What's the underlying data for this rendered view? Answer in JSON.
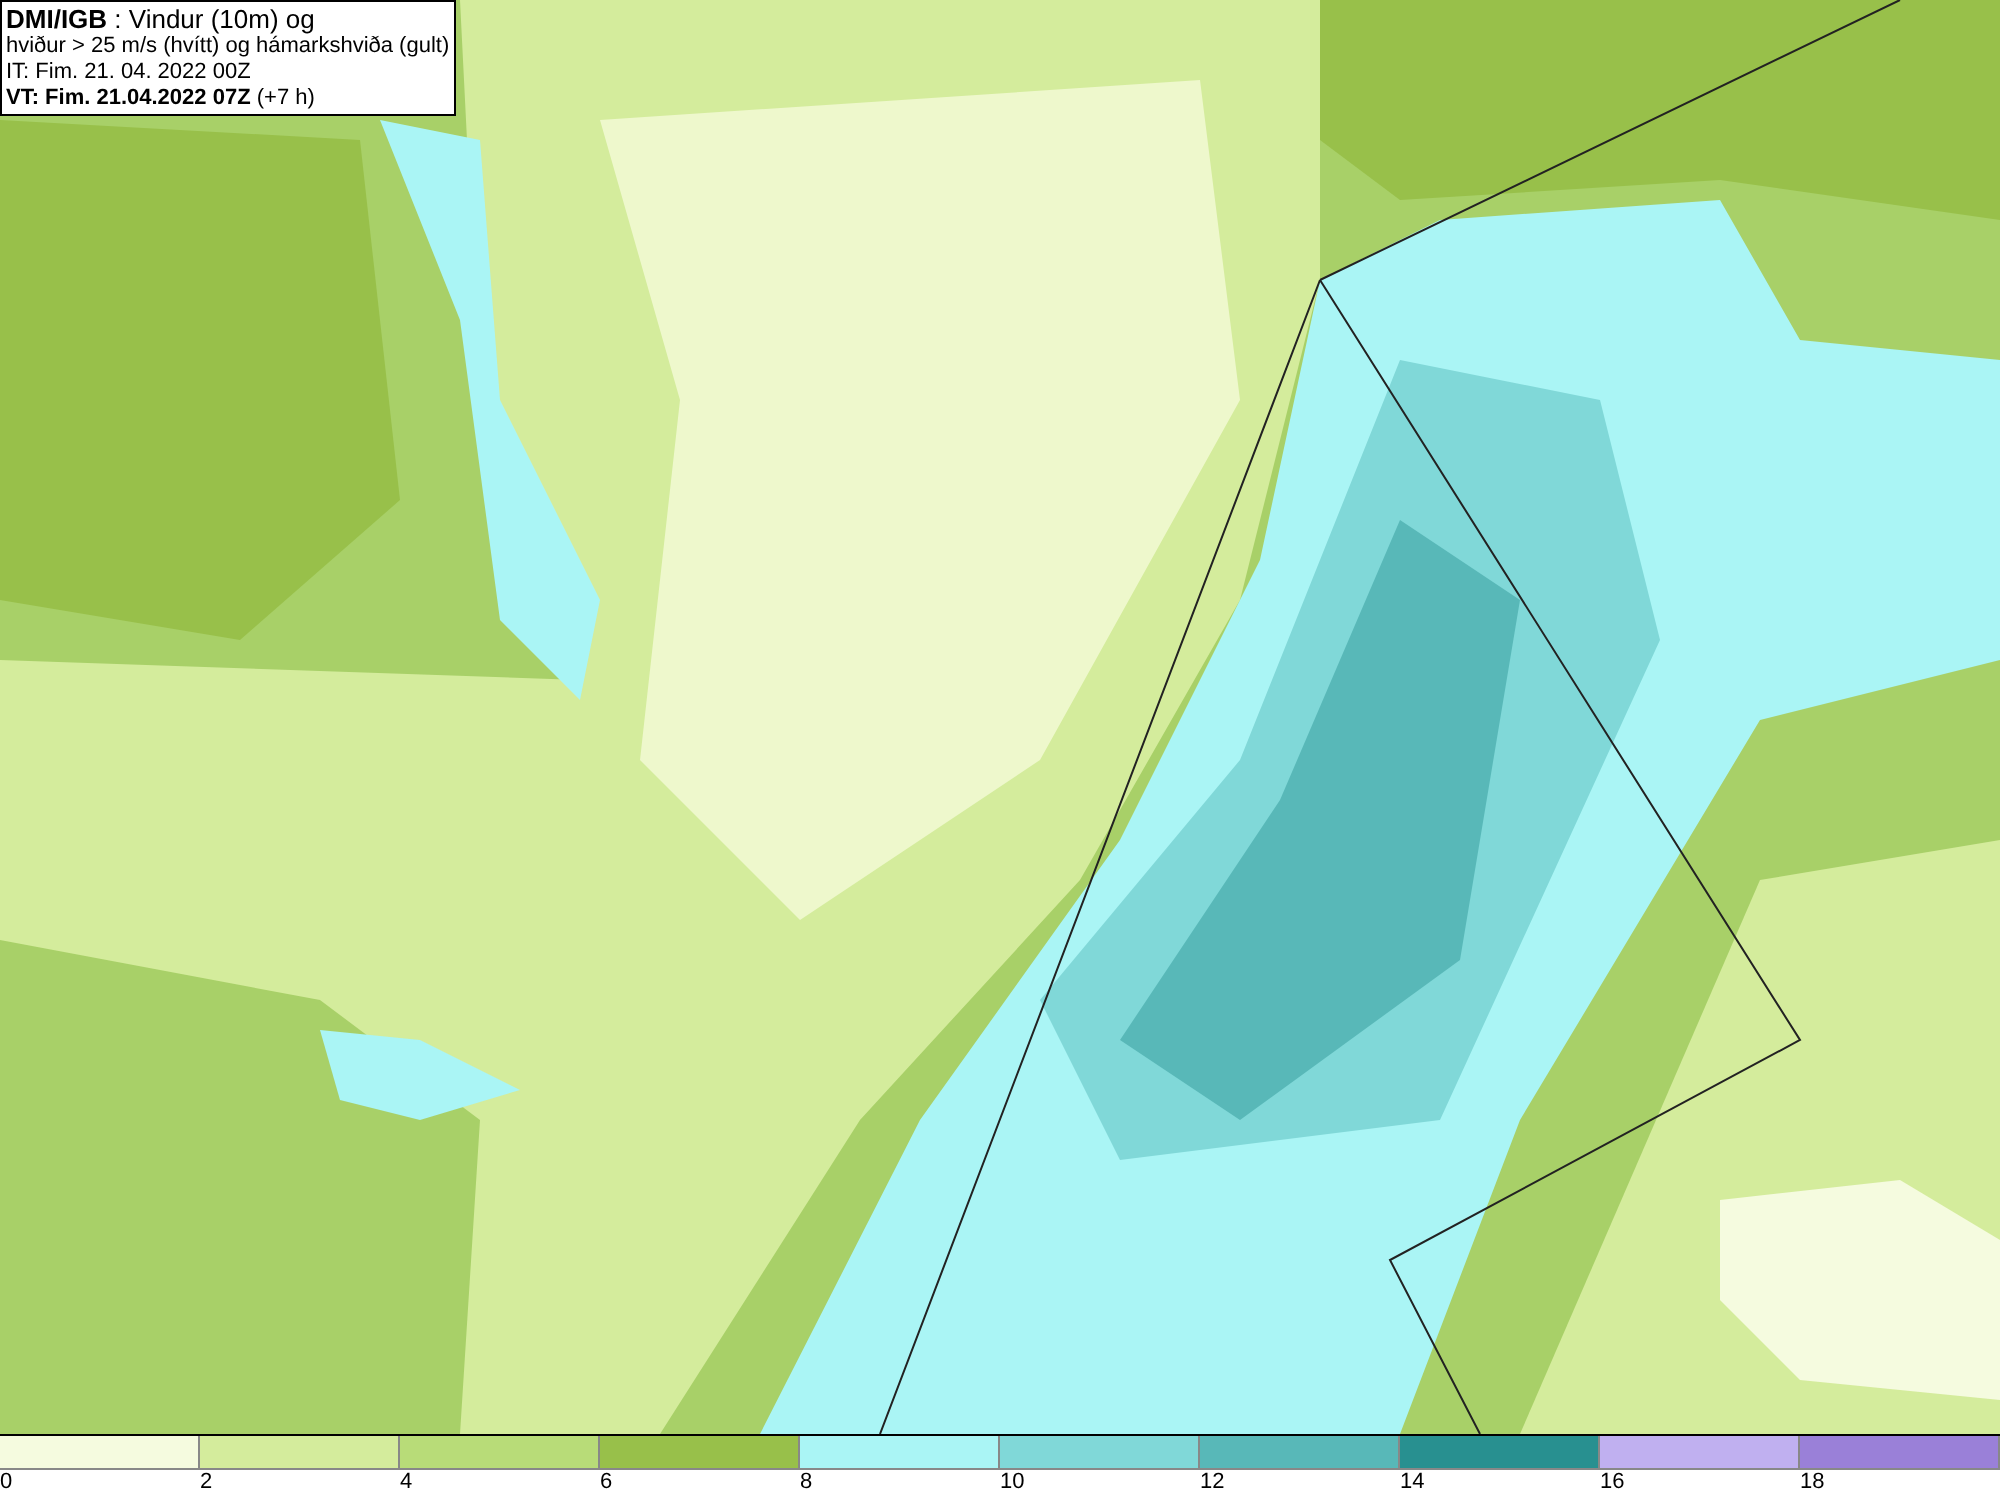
{
  "info_box": {
    "lines": [
      "**DMI/IGB** : Vindur (10m) og",
      "hviður > 25 m/s (hvítt) og hámarkshviða (gult)",
      "IT: Fim. 21. 04. 2022 00Z",
      "**VT: Fim. 21.04.2022 07Z** (+7 h)"
    ]
  },
  "legend": [
    {
      "color": "#f5fbdf",
      "label": "0"
    },
    {
      "color": "#d4ec9c",
      "label": "2"
    },
    {
      "color": "#b8dc78",
      "label": "4"
    },
    {
      "color": "#98c04a",
      "label": "6"
    },
    {
      "color": "#aaf5f5",
      "label": "8"
    },
    {
      "color": "#80d8d8",
      "label": "10"
    },
    {
      "color": "#58b8b8",
      "label": "12"
    },
    {
      "color": "#289090",
      "label": "14"
    },
    {
      "color": "#c0b0f0",
      "label": "16"
    },
    {
      "color": "#9a80d8",
      "label": "18"
    }
  ]
}
